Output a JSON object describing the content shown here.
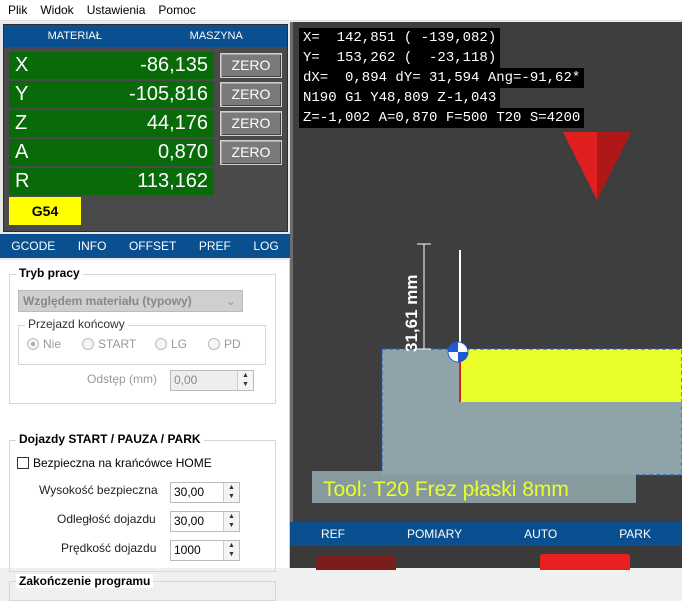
{
  "menu": [
    "Plik",
    "Widok",
    "Ustawienia",
    "Pomoc"
  ],
  "coords": {
    "headers": [
      "MATERIAŁ",
      "MASZYNA"
    ],
    "axes": [
      {
        "label": "X",
        "value": "-86,135",
        "zero": "ZERO"
      },
      {
        "label": "Y",
        "value": "-105,816",
        "zero": "ZERO"
      },
      {
        "label": "Z",
        "value": "44,176",
        "zero": "ZERO"
      },
      {
        "label": "A",
        "value": "0,870",
        "zero": "ZERO"
      },
      {
        "label": "R",
        "value": "113,162"
      }
    ],
    "wcs": "G54"
  },
  "tabs": [
    "GCODE",
    "INFO",
    "OFFSET",
    "PREF",
    "LOG"
  ],
  "mode": {
    "title": "Tryb pracy",
    "combo": "Względem materiału (typowy)",
    "endmove_title": "Przejazd końcowy",
    "radios": [
      "Nie",
      "START",
      "LG",
      "PD"
    ],
    "distance_label": "Odstęp (mm)",
    "distance_value": "0,00"
  },
  "approach": {
    "title": "Dojazdy START / PAUZA / PARK",
    "home_check": "Bezpieczna na krańcówce HOME",
    "fields": [
      {
        "label": "Wysokość bezpieczna",
        "value": "30,00"
      },
      {
        "label": "Odległość dojazdu",
        "value": "30,00"
      },
      {
        "label": "Prędkość dojazdu",
        "value": "1000"
      }
    ]
  },
  "program_end": {
    "title": "Zakończenie programu"
  },
  "dro_lines": [
    "X=  142,851 ( -139,082)",
    "Y=  153,262 (  -23,118)",
    "dX=  0,894 dY= 31,594 Ang=-91,62*",
    "N190 G1 Y48,809 Z-1,043",
    "Z=-1,002 A=0,870 F=500 T20 S=4200"
  ],
  "dimension_label": "31,61 mm",
  "tool_label": "Tool: T20 Frez płaski  8mm",
  "bottom_tabs": [
    "REF",
    "POMIARY",
    "AUTO",
    "PARK"
  ],
  "colors": {
    "accent": "#0a4f8f",
    "axis_bg": "#096a09",
    "wcs_bg": "#ffff00",
    "material": "#eaff29",
    "marker": "#e0201e"
  }
}
